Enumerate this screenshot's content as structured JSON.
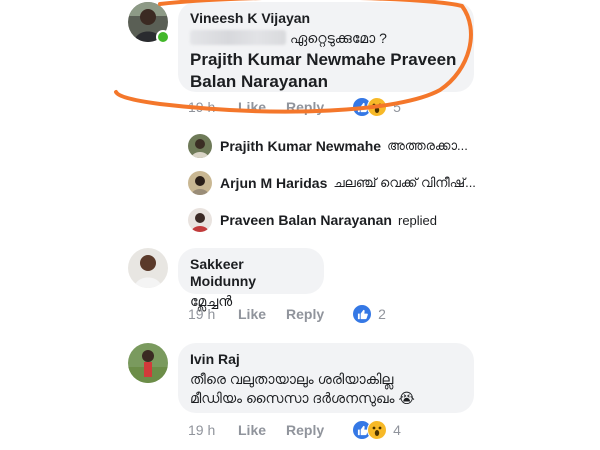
{
  "comments": [
    {
      "author": "Vineesh K Vijayan",
      "line1_text": "ഏറ്റെടുക്കുമോ ?",
      "tag_line1": "Prajith Kumar Newmahe Praveen",
      "tag_line2": "Balan Narayanan",
      "time": "19 h",
      "like": "Like",
      "reply": "Reply",
      "reaction_count": "5",
      "reactions": [
        "like",
        "wow"
      ]
    },
    {
      "author": "Sakkeer Moidunny",
      "text": "മ്ലേച്ചൻ",
      "time": "19 h",
      "like": "Like",
      "reply": "Reply",
      "reaction_count": "2",
      "reactions": [
        "like"
      ]
    },
    {
      "author": "Ivin Raj",
      "text_line1": "തീരെ വലുതായാലും ശരിയാകില്ല",
      "text_line2": "മീഡിയം സൈസാ ദർശനസുഖം",
      "emoji": "😭",
      "time": "19 h",
      "like": "Like",
      "reply": "Reply",
      "reaction_count": "4",
      "reactions": [
        "like",
        "wow"
      ]
    }
  ],
  "replies": [
    {
      "name": "Prajith Kumar Newmahe",
      "snippet": "അത്തരക്കാ..."
    },
    {
      "name": "Arjun M Haridas",
      "snippet": "ചലഞ്ച് വെക്ക് വിനീഷ്..."
    },
    {
      "name": "Praveen Balan Narayanan",
      "snippet": "replied"
    }
  ],
  "colors": {
    "bubble": "#f2f3f5",
    "muted": "#90949c",
    "like_blue": "#3b5998",
    "annotation": "#f4772b",
    "online": "#42b72a"
  }
}
